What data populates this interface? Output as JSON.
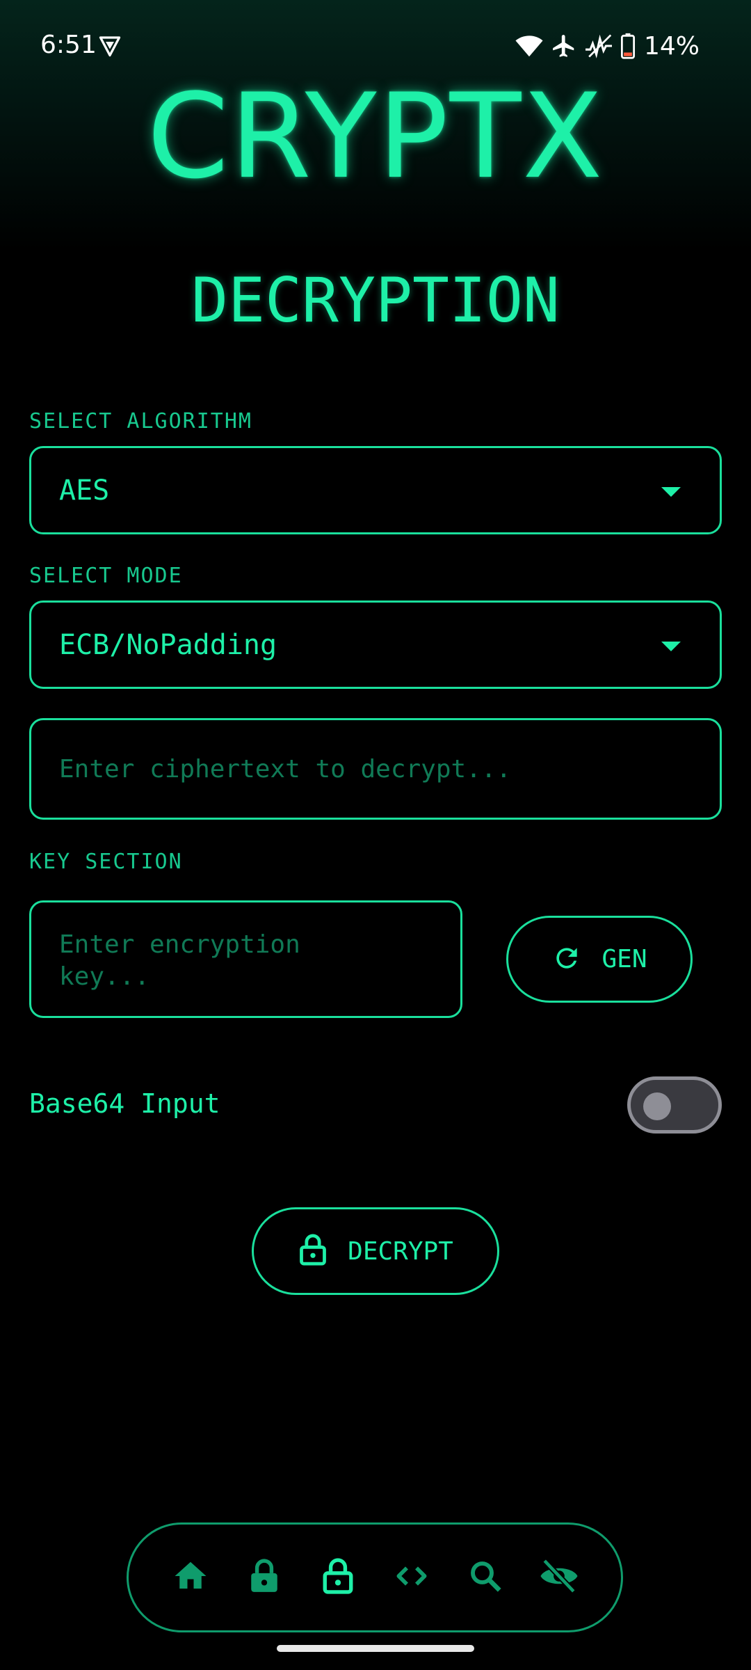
{
  "status_bar": {
    "time": "6:51",
    "battery_percent": "14%",
    "icons": [
      "vpn-shield-icon",
      "wifi-icon",
      "airplane-mode-icon",
      "signal-activity-icon",
      "battery-low-icon"
    ]
  },
  "app": {
    "title": "CRYPTX",
    "screen_title": "DECRYPTION"
  },
  "algorithm": {
    "label": "SELECT ALGORITHM",
    "value": "AES"
  },
  "mode": {
    "label": "SELECT MODE",
    "value": "ECB/NoPadding"
  },
  "ciphertext": {
    "value": "",
    "placeholder": "Enter ciphertext to decrypt..."
  },
  "key_section": {
    "label": "KEY SECTION",
    "key_value": "",
    "key_placeholder": "Enter encryption key...",
    "gen_button_label": "GEN"
  },
  "base64": {
    "label": "Base64 Input",
    "enabled": false
  },
  "decrypt_button": {
    "label": "DECRYPT"
  },
  "bottom_nav": {
    "items": [
      {
        "name": "home",
        "icon": "home-icon"
      },
      {
        "name": "encrypt",
        "icon": "lock-icon"
      },
      {
        "name": "decrypt",
        "icon": "unlock-icon",
        "active": true
      },
      {
        "name": "code",
        "icon": "code-icon"
      },
      {
        "name": "search",
        "icon": "search-icon"
      },
      {
        "name": "hide",
        "icon": "eye-off-icon"
      }
    ]
  },
  "colors": {
    "accent": "#1ef0a8",
    "accent_dim": "#0f9c6c",
    "background": "#000000",
    "placeholder": "#107a56"
  }
}
